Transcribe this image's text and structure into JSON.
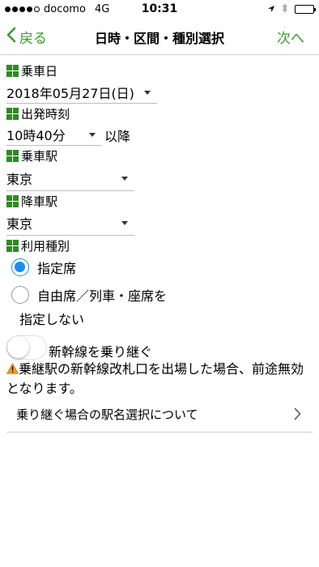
{
  "status_bar": {
    "carrier": "docomo",
    "network": "4G",
    "time": "10:31",
    "signal_filled": 4,
    "signal_total": 5,
    "icons": [
      "location-arrow-icon",
      "bluetooth-icon",
      "battery-icon"
    ],
    "battery_level": 0.9
  },
  "nav": {
    "back_label": "戻る",
    "title": "日時・区間・種別選択",
    "next_label": "次へ"
  },
  "form": {
    "date_label": "乗車日",
    "date_value": "2018年05月27日(日)",
    "departure_label": "出発時刻",
    "departure_value": "10時40分",
    "departure_suffix": "以降",
    "board_station_label": "乗車駅",
    "board_station_value": "東京",
    "alight_station_label": "降車駅",
    "alight_station_value": "東京",
    "seat_type_label": "利用種別",
    "seat_options": [
      {
        "label": "指定席",
        "selected": true
      },
      {
        "label_line1": "自由席／列車・座席を",
        "label_line2": "指定しない",
        "selected": false
      }
    ],
    "transfer_toggle_label": "新幹線を乗り継ぐ",
    "transfer_toggle_on": false,
    "warning_text": "乗継駅の新幹線改札口を出場した場合、前途無効となります。",
    "link_text": "乗り継ぐ場合の駅名選択について"
  },
  "colors": {
    "accent_green": "#3a9a2a",
    "icon_green": "#2f8a23",
    "radio_blue": "#1d8cf0",
    "warning_orange": "#f0a020"
  }
}
